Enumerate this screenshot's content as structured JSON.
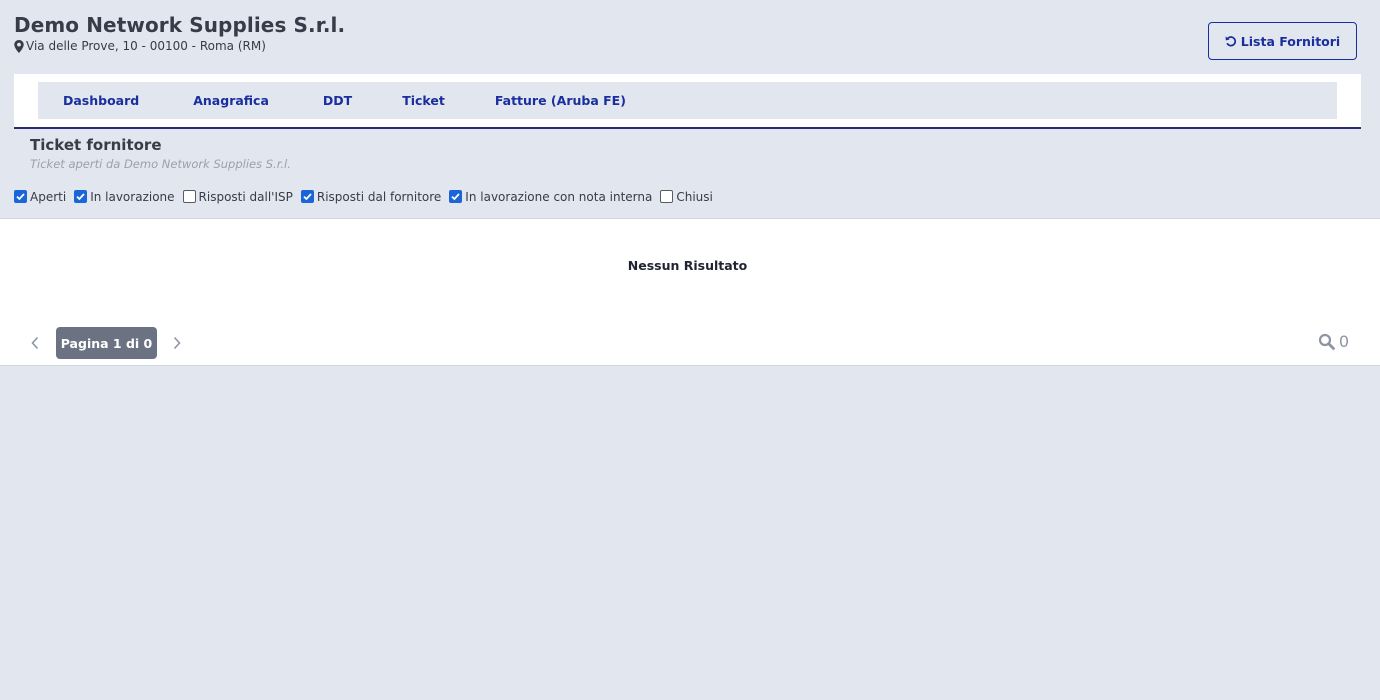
{
  "header": {
    "company_name": "Demo Network Supplies S.r.l.",
    "address": "Via delle Prove, 10 - 00100 - Roma (RM)",
    "back_button_label": "Lista Fornitori",
    "back_button_icon": "undo-icon",
    "address_icon": "map-marker-icon"
  },
  "nav": {
    "tabs": [
      {
        "label": "Dashboard"
      },
      {
        "label": "Anagrafica"
      },
      {
        "label": "DDT"
      },
      {
        "label": "Ticket"
      },
      {
        "label": "Fatture (Aruba FE)"
      }
    ]
  },
  "section": {
    "title": "Ticket fornitore",
    "subtitle": "Ticket aperti da Demo Network Supplies S.r.l."
  },
  "filters": [
    {
      "label": "Aperti",
      "checked": true
    },
    {
      "label": "In lavorazione",
      "checked": true
    },
    {
      "label": "Risposti dall'ISP",
      "checked": false
    },
    {
      "label": "Risposti dal fornitore",
      "checked": true
    },
    {
      "label": "In lavorazione con nota interna",
      "checked": true
    },
    {
      "label": "Chiusi",
      "checked": false
    }
  ],
  "results": {
    "empty_message": "Nessun Risultato",
    "page_label": "Pagina 1 di 0",
    "count": "0",
    "count_icon": "search-icon"
  },
  "colors": {
    "accent": "#1a2e9e",
    "checkbox": "#1a66d9",
    "background": "#e2e7ef"
  }
}
